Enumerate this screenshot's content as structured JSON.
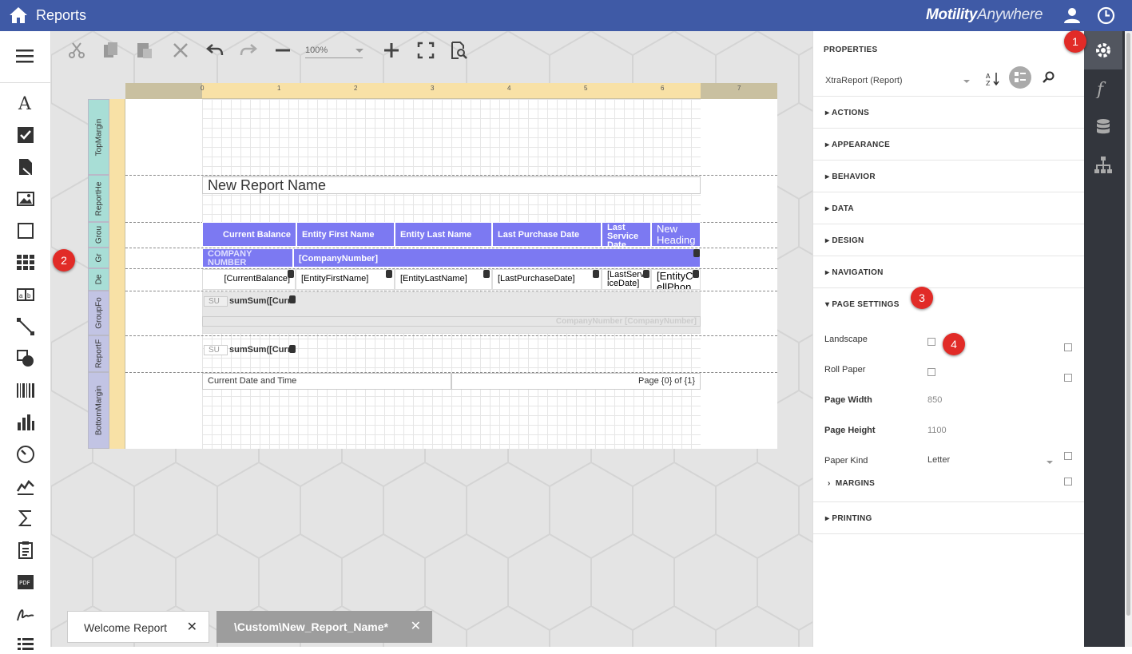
{
  "app": {
    "title": "Reports",
    "brand_bold": "Motility",
    "brand_rest": "Anywhere"
  },
  "left_tools": [
    "label-icon",
    "checkbox-icon",
    "rich-text-icon",
    "picture-box-icon",
    "panel-icon",
    "table-icon",
    "character-comb-icon",
    "line-icon",
    "shape-icon",
    "barcode-icon",
    "chart-icon",
    "gauge-icon",
    "sparkline-icon",
    "summary-icon",
    "page-info-icon",
    "pdf-content-icon",
    "signature-icon",
    "table-of-contents-icon"
  ],
  "toolbar": {
    "zoom_value": "100%"
  },
  "ruler": {
    "ticks": [
      "0",
      "1",
      "2",
      "3",
      "4",
      "5",
      "6",
      "7"
    ]
  },
  "bands": {
    "top_margin": "TopMargin",
    "report_header": "ReportHe",
    "group_header1": "Grou",
    "group_header2": "Gr",
    "detail": "De",
    "group_footer": "GroupFo",
    "report_footer": "ReportF",
    "bottom_margin": "BottomMargin"
  },
  "report": {
    "title": "New Report Name",
    "headers": [
      "Current Balance",
      "Entity First Name",
      "Entity Last Name",
      "Last Purchase Date",
      "Last Service Date",
      "New Heading"
    ],
    "group_label": "COMPANY NUMBER",
    "group_value": "[CompanyNumber]",
    "detail": [
      "[CurrentBalance]",
      "[EntityFirstName]",
      "[EntityLastName]",
      "[LastPurchaseDate]",
      "[LastServiceDate]",
      "[EntityCellPhon"
    ],
    "su_label": "SU",
    "sum_expr": "sumSum([Curr",
    "group_footer_text": "CompanyNumber [CompanyNumber]",
    "footer_left": "Current Date and Time",
    "footer_right": "Page {0} of {1}"
  },
  "tabs": [
    {
      "label": "Welcome Report"
    },
    {
      "label": "\\Custom\\New_Report_Name*"
    }
  ],
  "properties": {
    "heading": "PROPERTIES",
    "object": "XtraReport (Report)",
    "sections": [
      "ACTIONS",
      "APPEARANCE",
      "BEHAVIOR",
      "DATA",
      "DESIGN",
      "NAVIGATION",
      "PAGE SETTINGS"
    ],
    "page_settings": {
      "landscape_label": "Landscape",
      "roll_paper_label": "Roll Paper",
      "page_width_label": "Page Width",
      "page_width_value": "850",
      "page_height_label": "Page Height",
      "page_height_value": "1100",
      "paper_kind_label": "Paper Kind",
      "paper_kind_value": "Letter",
      "margins_label": "MARGINS"
    },
    "printing": "PRINTING"
  },
  "badges": [
    "1",
    "2",
    "3",
    "4"
  ],
  "colors": {
    "topbar": "#3f5aa6",
    "header_cell": "#7c79f2",
    "badge": "#e12b27",
    "rightbar": "#33363d"
  }
}
